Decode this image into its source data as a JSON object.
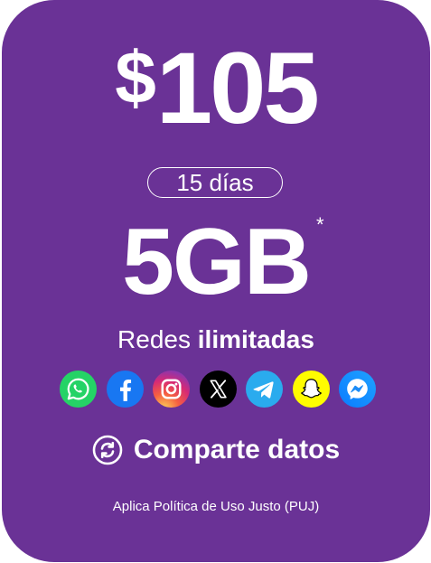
{
  "plan": {
    "currency_symbol": "$",
    "price": "105",
    "duration": "15 días",
    "data_amount": "5GB",
    "data_footnote_mark": "*",
    "social_prefix": "Redes",
    "social_emphasis": "ilimitadas",
    "share_label": "Comparte datos",
    "policy_note": "Aplica Política de Uso Justo (PUJ)"
  },
  "social_icons": [
    "whatsapp-icon",
    "facebook-icon",
    "instagram-icon",
    "x-icon",
    "telegram-icon",
    "snapchat-icon",
    "messenger-icon"
  ],
  "colors": {
    "card_background": "#6a3296",
    "text": "#ffffff",
    "whatsapp": "#25d366",
    "facebook": "#1877f2",
    "instagram": "#e1306c",
    "x": "#000000",
    "telegram": "#2aabee",
    "snapchat": "#fffc00",
    "messenger": "#1b8cf7"
  }
}
